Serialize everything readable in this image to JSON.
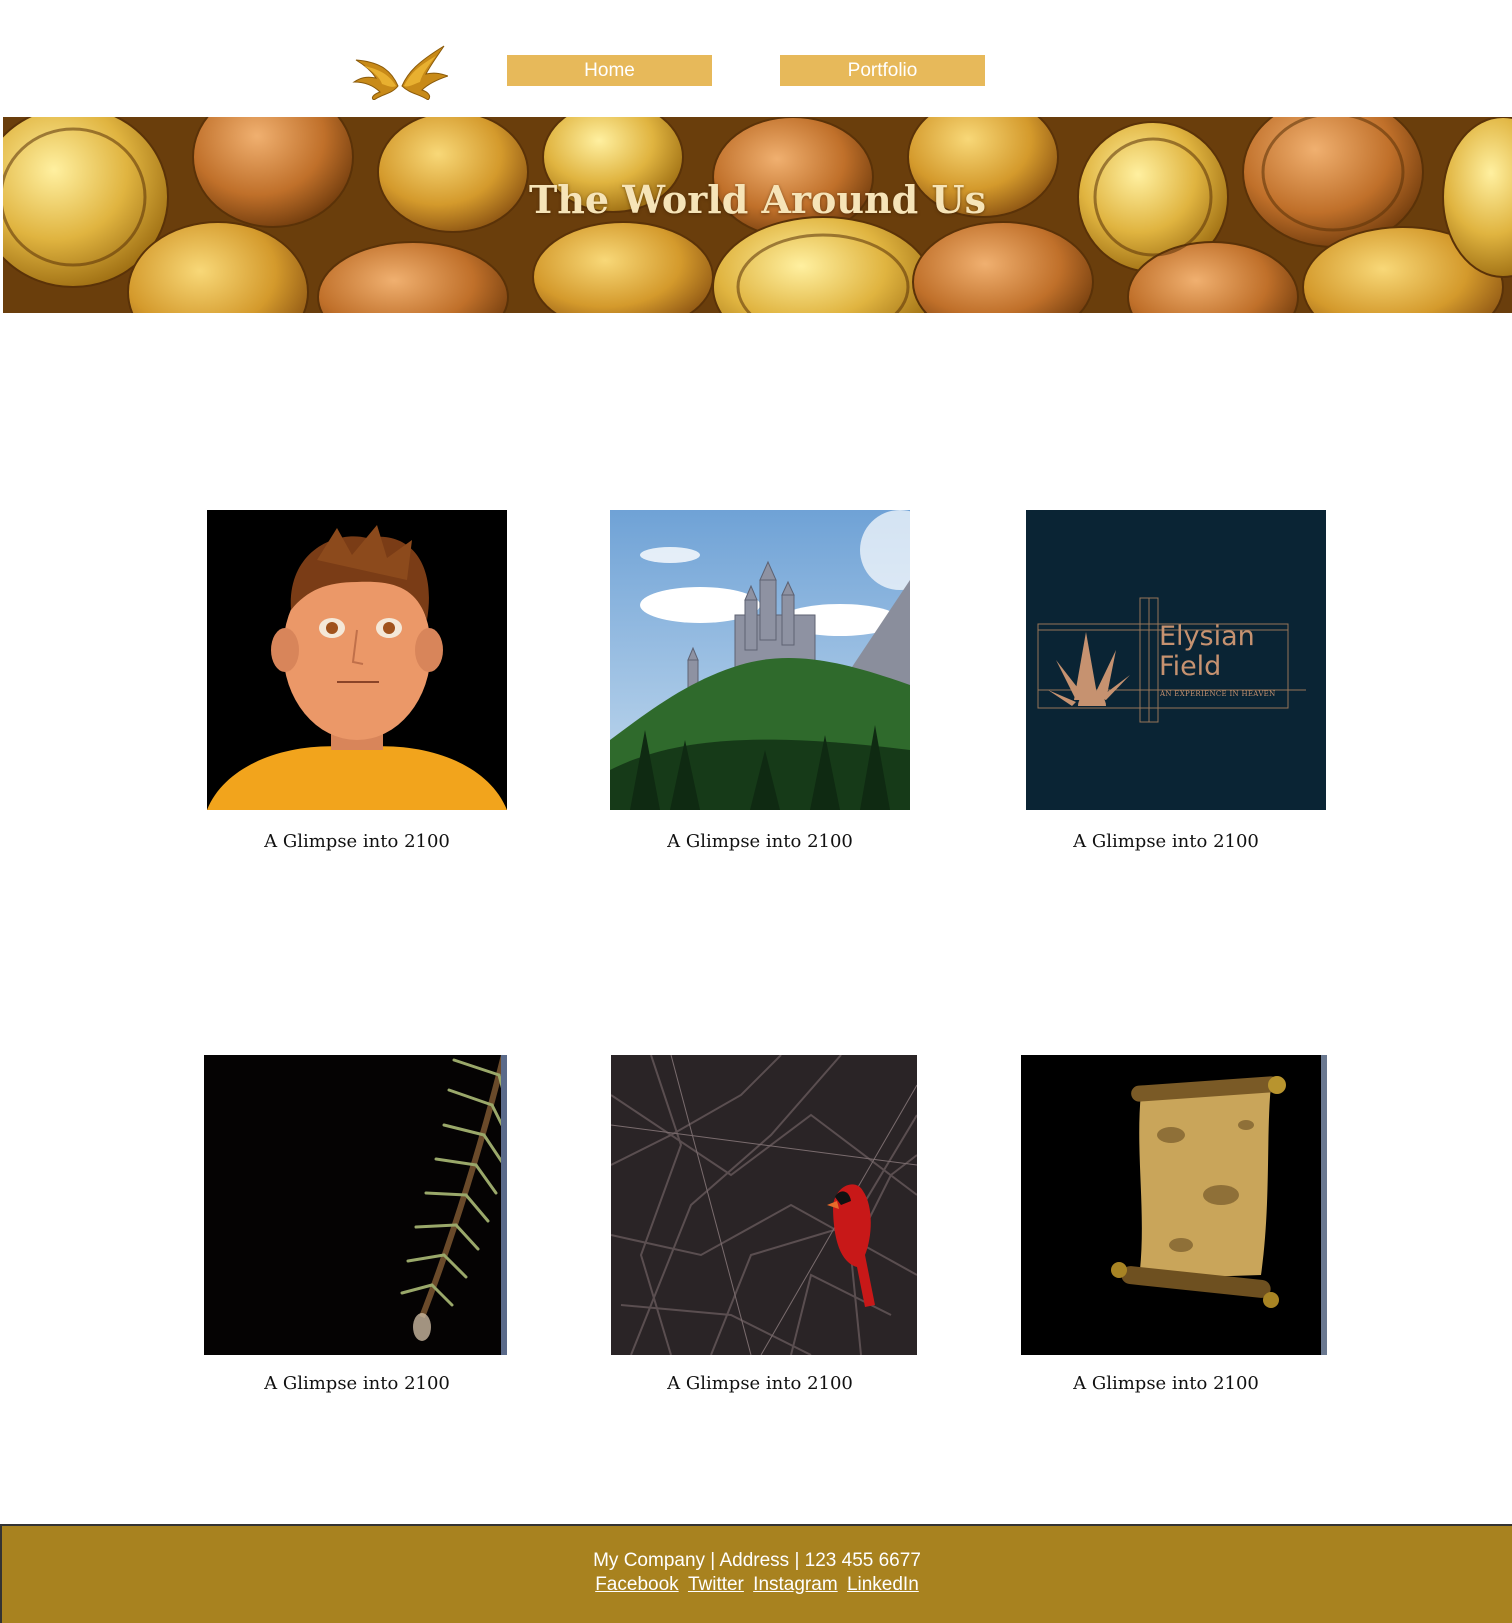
{
  "nav": {
    "logo_icon": "golden-wings-logo",
    "home_label": "Home",
    "portfolio_label": "Portfolio",
    "accent_color": "#e7b95a"
  },
  "hero": {
    "title": "The World Around Us",
    "background": "gold-coins-photo"
  },
  "gallery": {
    "items": [
      {
        "caption": "A Glimpse into 2100",
        "image": "3d-boy-portrait"
      },
      {
        "caption": "A Glimpse into 2100",
        "image": "castle-on-hill-painting"
      },
      {
        "caption": "A Glimpse into 2100",
        "image": "elysian-field-logo",
        "image_text": [
          "Elysian",
          "Field",
          "AN EXPERIENCE IN HEAVEN"
        ]
      },
      {
        "caption": "A Glimpse into 2100",
        "image": "pine-branch-droplet"
      },
      {
        "caption": "A Glimpse into 2100",
        "image": "cardinal-in-branches"
      },
      {
        "caption": "A Glimpse into 2100",
        "image": "parchment-scroll"
      }
    ]
  },
  "footer": {
    "info": "My Company | Address | 123 455 6677",
    "links": [
      "Facebook",
      "Twitter",
      "Instagram",
      "LinkedIn"
    ],
    "background_color": "#a8821f"
  }
}
